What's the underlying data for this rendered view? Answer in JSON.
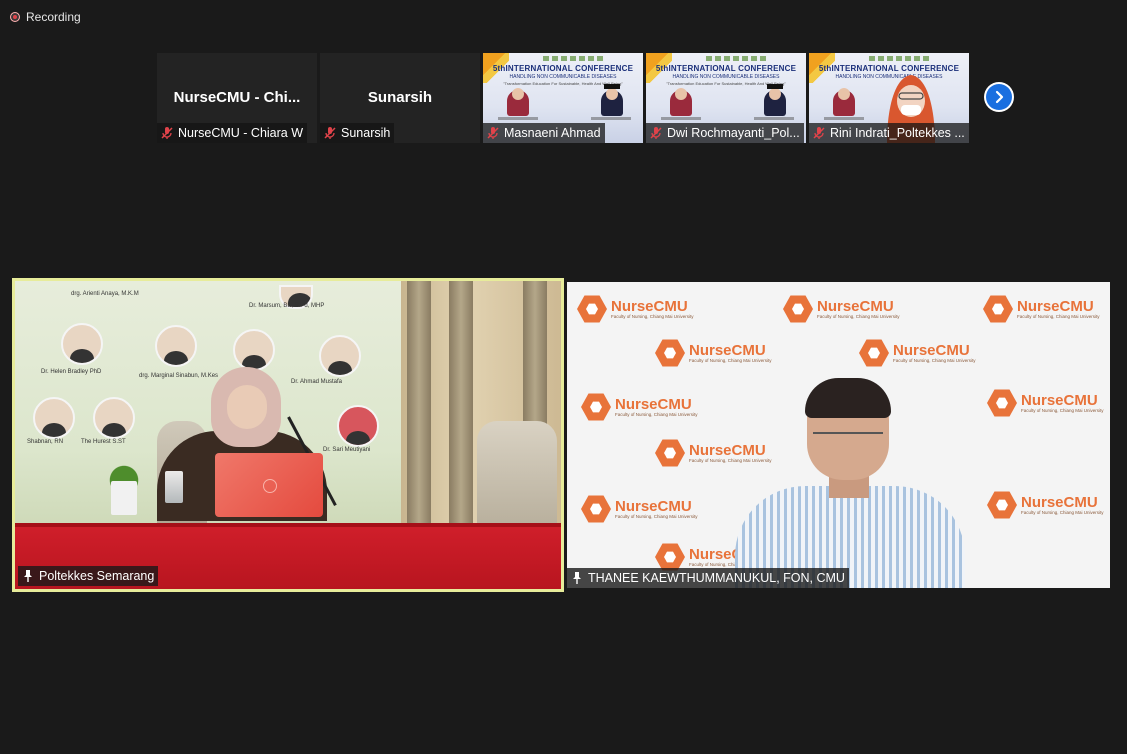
{
  "recording": {
    "label": "Recording"
  },
  "participants_strip": {
    "tiles": [
      {
        "big_name": "NurseCMU  -  Chi...",
        "tag": "NurseCMU - Chiara W",
        "muted": true,
        "video": false
      },
      {
        "big_name": "Sunarsih",
        "tag": "Sunarsih",
        "muted": true,
        "video": false
      },
      {
        "tag": "Masnaeni Ahmad",
        "muted": true,
        "video": true
      },
      {
        "tag": "Dwi Rochmayanti_Pol...",
        "muted": true,
        "video": true
      },
      {
        "tag": "Rini Indrati_Poltekkes ...",
        "muted": true,
        "video": true
      }
    ],
    "next_icon": "chevron-right-icon"
  },
  "poster": {
    "title": "5thINTERNATIONAL CONFERENCE",
    "subtitle": "HANDLING NON COMMUNICABLE DISEASES",
    "tagline": "\"Transformation Education For Sustainable, Health And Well Being\""
  },
  "main_videos": [
    {
      "name": "Poltekkes Semarang",
      "pinned": true,
      "active_speaker": true,
      "stage_labels": [
        "drg. Arienti Anaya, M.K.M",
        "Dr. Marsum, BE, S.Pd, MHP",
        "drg. Marginal Sinabun, M.Kes",
        "Dr. Helen Bradley PhD",
        "Dr. Ahmad Mustafa",
        "Shabnan, RN",
        "The Hurest S.ST",
        "Dr. Sari Meutiyani"
      ]
    },
    {
      "name": "THANEE KAEWTHUMMANUKUL, FON, CMU",
      "pinned": true,
      "active_speaker": false,
      "backdrop_brand": "NurseCMU",
      "backdrop_tag": "Faculty of Nursing, Chiang Mai University"
    }
  ],
  "colors": {
    "background": "#1a1a1a",
    "active_speaker_border": "#e7ec9a",
    "recording_dot": "#e0434a",
    "next_button": "#1a6fe0",
    "brand_orange": "#e8733a"
  }
}
